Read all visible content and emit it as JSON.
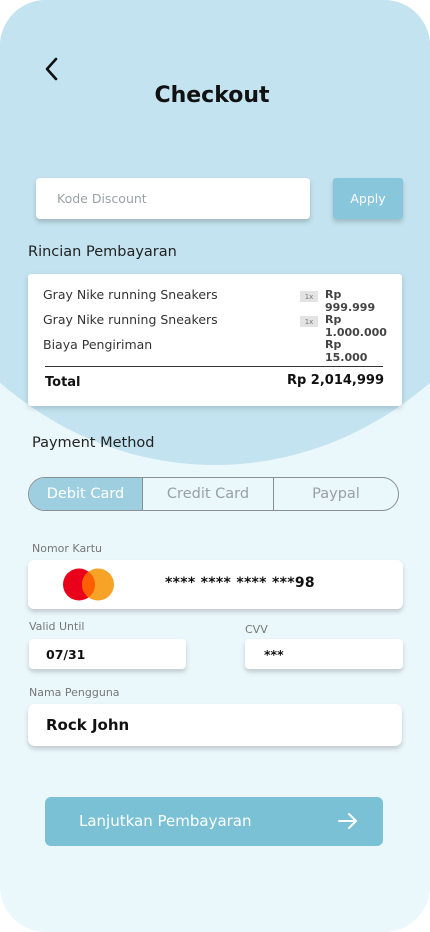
{
  "header": {
    "title": "Checkout"
  },
  "discount": {
    "placeholder": "Kode Discount",
    "apply_label": "Apply"
  },
  "summary": {
    "heading": "Rincian Pembayaran",
    "items": [
      {
        "name": "Gray Nike running Sneakers",
        "qty": "1x",
        "price": "Rp 999.999"
      },
      {
        "name": "Gray Nike running Sneakers",
        "qty": "1x",
        "price": "Rp 1.000.000"
      },
      {
        "name": "Biaya Pengiriman",
        "qty": "",
        "price": "Rp 15.000"
      }
    ],
    "total_label": "Total",
    "total_value": "Rp 2,014,999"
  },
  "payment": {
    "heading": "Payment Method",
    "methods": [
      "Debit Card",
      "Credit Card",
      "Paypal"
    ],
    "selected": "Debit Card"
  },
  "card": {
    "number_label": "Nomor Kartu",
    "number": "**** **** **** ***98",
    "brand_icon": "mastercard-icon",
    "valid_label": "Valid Until",
    "valid_value": "07/31",
    "cvv_label": "CVV",
    "cvv_value": "***",
    "name_label": "Nama Pengguna",
    "name_value": "Rock John"
  },
  "actions": {
    "continue_label": "Lanjutkan Pembayaran"
  },
  "colors": {
    "background": "#eaf7fb",
    "header_blob": "#c2e3ef",
    "accent": "#88c6dc",
    "primary_button": "#7bc1d6",
    "segment_active": "#9dcfe0",
    "mastercard_red": "#eb001b",
    "mastercard_orange": "#f79e1b"
  }
}
